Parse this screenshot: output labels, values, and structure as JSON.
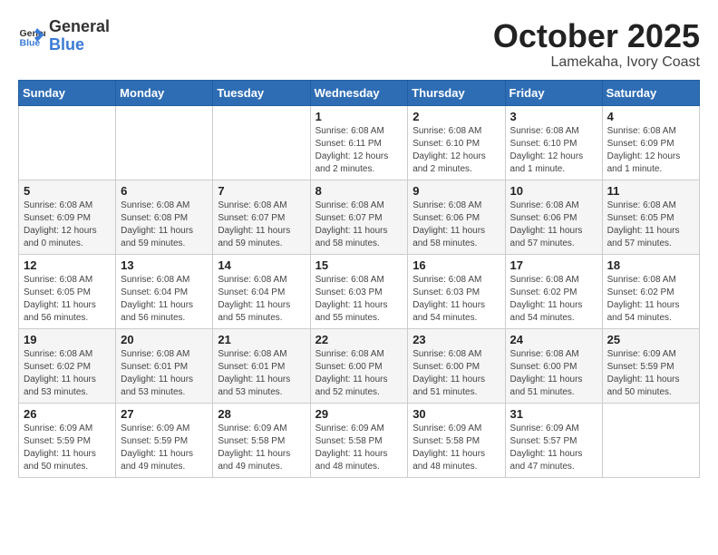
{
  "header": {
    "logo_general": "General",
    "logo_blue": "Blue",
    "month": "October 2025",
    "location": "Lamekaha, Ivory Coast"
  },
  "weekdays": [
    "Sunday",
    "Monday",
    "Tuesday",
    "Wednesday",
    "Thursday",
    "Friday",
    "Saturday"
  ],
  "weeks": [
    [
      {
        "day": "",
        "info": ""
      },
      {
        "day": "",
        "info": ""
      },
      {
        "day": "",
        "info": ""
      },
      {
        "day": "1",
        "info": "Sunrise: 6:08 AM\nSunset: 6:11 PM\nDaylight: 12 hours and 2 minutes."
      },
      {
        "day": "2",
        "info": "Sunrise: 6:08 AM\nSunset: 6:10 PM\nDaylight: 12 hours and 2 minutes."
      },
      {
        "day": "3",
        "info": "Sunrise: 6:08 AM\nSunset: 6:10 PM\nDaylight: 12 hours and 1 minute."
      },
      {
        "day": "4",
        "info": "Sunrise: 6:08 AM\nSunset: 6:09 PM\nDaylight: 12 hours and 1 minute."
      }
    ],
    [
      {
        "day": "5",
        "info": "Sunrise: 6:08 AM\nSunset: 6:09 PM\nDaylight: 12 hours and 0 minutes."
      },
      {
        "day": "6",
        "info": "Sunrise: 6:08 AM\nSunset: 6:08 PM\nDaylight: 11 hours and 59 minutes."
      },
      {
        "day": "7",
        "info": "Sunrise: 6:08 AM\nSunset: 6:07 PM\nDaylight: 11 hours and 59 minutes."
      },
      {
        "day": "8",
        "info": "Sunrise: 6:08 AM\nSunset: 6:07 PM\nDaylight: 11 hours and 58 minutes."
      },
      {
        "day": "9",
        "info": "Sunrise: 6:08 AM\nSunset: 6:06 PM\nDaylight: 11 hours and 58 minutes."
      },
      {
        "day": "10",
        "info": "Sunrise: 6:08 AM\nSunset: 6:06 PM\nDaylight: 11 hours and 57 minutes."
      },
      {
        "day": "11",
        "info": "Sunrise: 6:08 AM\nSunset: 6:05 PM\nDaylight: 11 hours and 57 minutes."
      }
    ],
    [
      {
        "day": "12",
        "info": "Sunrise: 6:08 AM\nSunset: 6:05 PM\nDaylight: 11 hours and 56 minutes."
      },
      {
        "day": "13",
        "info": "Sunrise: 6:08 AM\nSunset: 6:04 PM\nDaylight: 11 hours and 56 minutes."
      },
      {
        "day": "14",
        "info": "Sunrise: 6:08 AM\nSunset: 6:04 PM\nDaylight: 11 hours and 55 minutes."
      },
      {
        "day": "15",
        "info": "Sunrise: 6:08 AM\nSunset: 6:03 PM\nDaylight: 11 hours and 55 minutes."
      },
      {
        "day": "16",
        "info": "Sunrise: 6:08 AM\nSunset: 6:03 PM\nDaylight: 11 hours and 54 minutes."
      },
      {
        "day": "17",
        "info": "Sunrise: 6:08 AM\nSunset: 6:02 PM\nDaylight: 11 hours and 54 minutes."
      },
      {
        "day": "18",
        "info": "Sunrise: 6:08 AM\nSunset: 6:02 PM\nDaylight: 11 hours and 54 minutes."
      }
    ],
    [
      {
        "day": "19",
        "info": "Sunrise: 6:08 AM\nSunset: 6:02 PM\nDaylight: 11 hours and 53 minutes."
      },
      {
        "day": "20",
        "info": "Sunrise: 6:08 AM\nSunset: 6:01 PM\nDaylight: 11 hours and 53 minutes."
      },
      {
        "day": "21",
        "info": "Sunrise: 6:08 AM\nSunset: 6:01 PM\nDaylight: 11 hours and 53 minutes."
      },
      {
        "day": "22",
        "info": "Sunrise: 6:08 AM\nSunset: 6:00 PM\nDaylight: 11 hours and 52 minutes."
      },
      {
        "day": "23",
        "info": "Sunrise: 6:08 AM\nSunset: 6:00 PM\nDaylight: 11 hours and 51 minutes."
      },
      {
        "day": "24",
        "info": "Sunrise: 6:08 AM\nSunset: 6:00 PM\nDaylight: 11 hours and 51 minutes."
      },
      {
        "day": "25",
        "info": "Sunrise: 6:09 AM\nSunset: 5:59 PM\nDaylight: 11 hours and 50 minutes."
      }
    ],
    [
      {
        "day": "26",
        "info": "Sunrise: 6:09 AM\nSunset: 5:59 PM\nDaylight: 11 hours and 50 minutes."
      },
      {
        "day": "27",
        "info": "Sunrise: 6:09 AM\nSunset: 5:59 PM\nDaylight: 11 hours and 49 minutes."
      },
      {
        "day": "28",
        "info": "Sunrise: 6:09 AM\nSunset: 5:58 PM\nDaylight: 11 hours and 49 minutes."
      },
      {
        "day": "29",
        "info": "Sunrise: 6:09 AM\nSunset: 5:58 PM\nDaylight: 11 hours and 48 minutes."
      },
      {
        "day": "30",
        "info": "Sunrise: 6:09 AM\nSunset: 5:58 PM\nDaylight: 11 hours and 48 minutes."
      },
      {
        "day": "31",
        "info": "Sunrise: 6:09 AM\nSunset: 5:57 PM\nDaylight: 11 hours and 47 minutes."
      },
      {
        "day": "",
        "info": ""
      }
    ]
  ]
}
